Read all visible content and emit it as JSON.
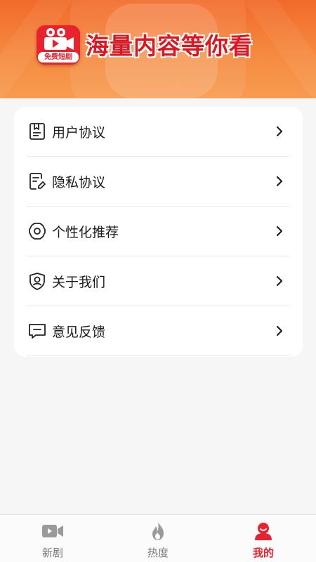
{
  "banner": {
    "logo_text": "免费短剧",
    "slogan": "海量内容等你看"
  },
  "menu": [
    {
      "label": "用户协议",
      "icon": "document-icon"
    },
    {
      "label": "隐私协议",
      "icon": "privacy-edit-icon"
    },
    {
      "label": "个性化推荐",
      "icon": "gear-icon"
    },
    {
      "label": "关于我们",
      "icon": "user-shield-icon"
    },
    {
      "label": "意见反馈",
      "icon": "chat-icon"
    }
  ],
  "tabbar": {
    "tabs": [
      {
        "label": "新剧",
        "icon": "video-camera-icon",
        "active": false
      },
      {
        "label": "热度",
        "icon": "flame-icon",
        "active": false
      },
      {
        "label": "我的",
        "icon": "user-icon",
        "active": true
      }
    ]
  },
  "colors": {
    "accent": "#e8232f",
    "banner_top": "#f26a2a",
    "banner_bottom": "#f79b50",
    "inactive": "#777777"
  }
}
